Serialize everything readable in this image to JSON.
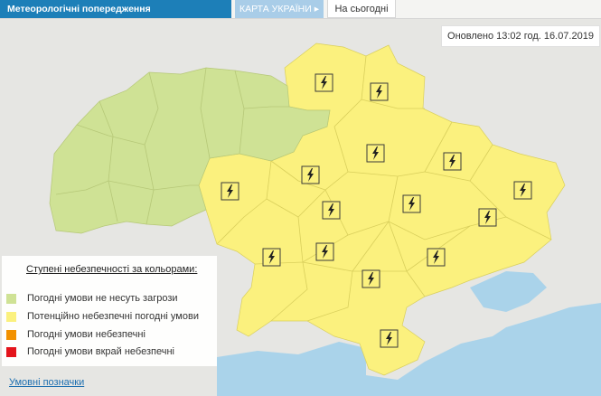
{
  "tabs": {
    "warnings": "Метеорологічні попередження",
    "map": "КАРТА УКРАЇНИ ▸",
    "today": "На сьогодні"
  },
  "updated": "Оновлено 13:02 год. 16.07.2019",
  "legend": {
    "title": "Ступені небезпечності за кольорами:",
    "items": [
      {
        "label": "Погодні умови не несуть загрози",
        "color": "#cfe295"
      },
      {
        "label": "Потенційно небезпечні погодні умови",
        "color": "#fbf17e"
      },
      {
        "label": "Погодні умови небезпечні",
        "color": "#f29100"
      },
      {
        "label": "Погодні умови вкрай небезпечні",
        "color": "#e4141b"
      }
    ]
  },
  "link": "Умовні позначки",
  "colors": {
    "safe": "#cfe295",
    "potential": "#fbf17e",
    "sea": "#aad3ea",
    "background": "#e6e6e3",
    "tab_active": "#1d7fb8"
  },
  "warning_icon": "lightning-icon"
}
